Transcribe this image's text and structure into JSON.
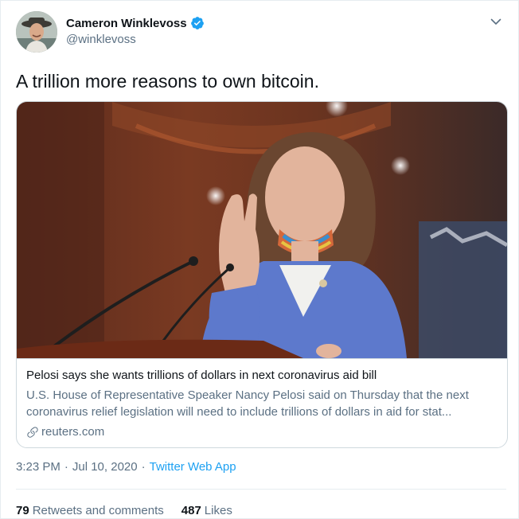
{
  "author": {
    "display_name": "Cameron Winklevoss",
    "handle": "@winklevoss",
    "verified": true
  },
  "tweet": {
    "text": "A trillion more reasons to own bitcoin."
  },
  "card": {
    "title": "Pelosi says she wants trillions of dollars in next coronavirus aid bill",
    "description": "U.S. House of Representative Speaker Nancy Pelosi said on Thursday that the next coronavirus relief legislation will need to include trillions of dollars in aid for stat...",
    "domain": "reuters.com"
  },
  "meta": {
    "time": "3:23 PM",
    "date": "Jul 10, 2020",
    "separator": "·",
    "app": "Twitter Web App"
  },
  "stats": {
    "retweets_count": "79",
    "retweets_label": "Retweets and comments",
    "likes_count": "487",
    "likes_label": "Likes"
  },
  "colors": {
    "accent": "#1da1f2",
    "secondary_text": "#5b7083",
    "primary_text": "#0f1419",
    "border": "#cfd9de"
  },
  "icons": {
    "verified": "verified-badge-icon",
    "caret": "chevron-down-icon",
    "link": "link-icon"
  }
}
